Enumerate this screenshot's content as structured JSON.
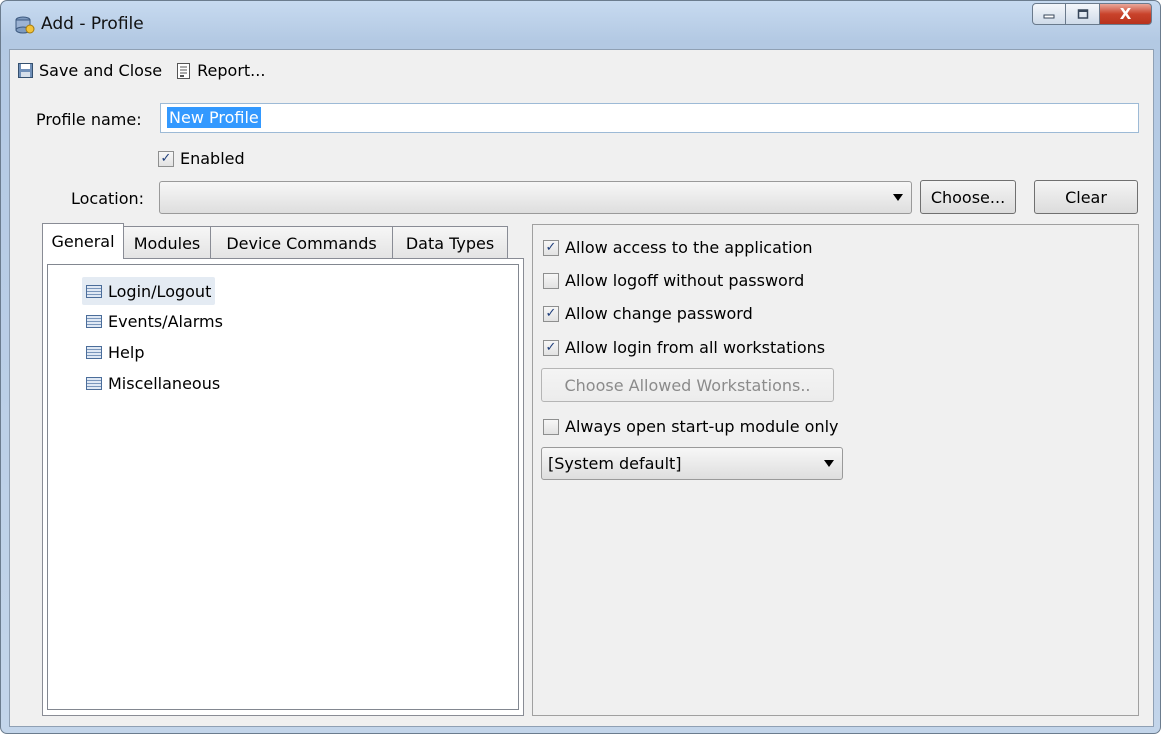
{
  "window": {
    "title": "Add - Profile",
    "caption_buttons": {
      "minimize": "—",
      "maximize": "□",
      "close": "X"
    }
  },
  "toolbar": {
    "save_close_label": "Save and Close",
    "report_label": "Report..."
  },
  "form": {
    "profile_name_label": "Profile name:",
    "profile_name_value": "New Profile",
    "enabled_label": "Enabled",
    "enabled_checked": true,
    "location_label": "Location:",
    "location_value": "",
    "choose_button": "Choose...",
    "clear_button": "Clear"
  },
  "tabs": [
    {
      "label": "General",
      "active": true
    },
    {
      "label": "Modules",
      "active": false
    },
    {
      "label": "Device Commands",
      "active": false
    },
    {
      "label": "Data Types",
      "active": false
    }
  ],
  "tree": {
    "items": [
      "Login/Logout",
      "Events/Alarms",
      "Help",
      "Miscellaneous"
    ],
    "selected": "Login/Logout"
  },
  "options": {
    "allow_access": {
      "label": "Allow access to the application",
      "checked": true
    },
    "allow_logoff": {
      "label": "Allow logoff without password",
      "checked": false
    },
    "allow_change_pw": {
      "label": "Allow change password",
      "checked": true
    },
    "allow_login_all": {
      "label": "Allow login from all workstations",
      "checked": true
    },
    "choose_workstations_button": "Choose Allowed Workstations..",
    "always_open_startup": {
      "label": "Always open start-up module only",
      "checked": false
    },
    "startup_module_select": "[System default]"
  },
  "colors": {
    "selection": "#3399ff",
    "check": "#1f3e7a",
    "title_gradient": "#c7daf0"
  }
}
